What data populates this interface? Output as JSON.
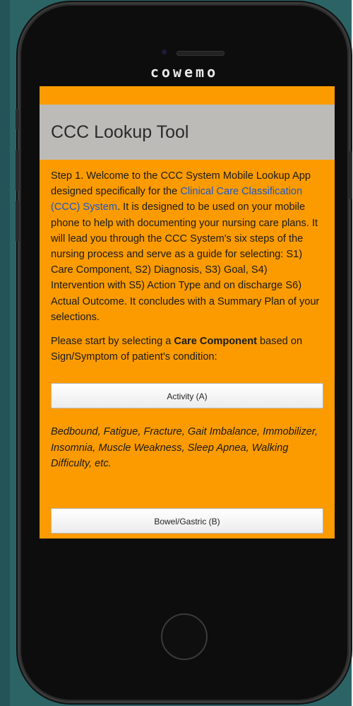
{
  "device": {
    "brand": "cowemo"
  },
  "app": {
    "title": "CCC Lookup Tool",
    "intro": {
      "before_link": "Step 1. Welcome to the CCC System Mobile Lookup App designed specifically for the ",
      "link_text": "Clinical Care Classification (CCC) System",
      "after_link": ". It is designed to be used on your mobile phone to help with documenting your nursing care plans. It will lead you through the CCC System's six steps of the nursing process and serve as a guide for selecting: S1) Care Component, S2) Diagnosis, S3) Goal, S4) Intervention with S5) Action Type and on discharge S6) Actual Outcome. It concludes with a Summary Plan of your selections."
    },
    "prompt": {
      "before": "Please start by selecting a ",
      "bold": "Care Component",
      "after": " based on Sign/Symptom of patient's condition:"
    },
    "components": [
      {
        "label": "Activity (A)",
        "examples": "Bedbound, Fatigue, Fracture, Gait Imbalance, Immobilizer, Insomnia, Muscle Weakness, Sleep Apnea, Walking Difficulty, etc."
      },
      {
        "label": "Bowel/Gastric (B)"
      }
    ]
  },
  "colors": {
    "screen_background": "#fb9b00",
    "title_bar": "#bcbbb7",
    "link": "#1a57c8",
    "backdrop": "#2c6466"
  }
}
